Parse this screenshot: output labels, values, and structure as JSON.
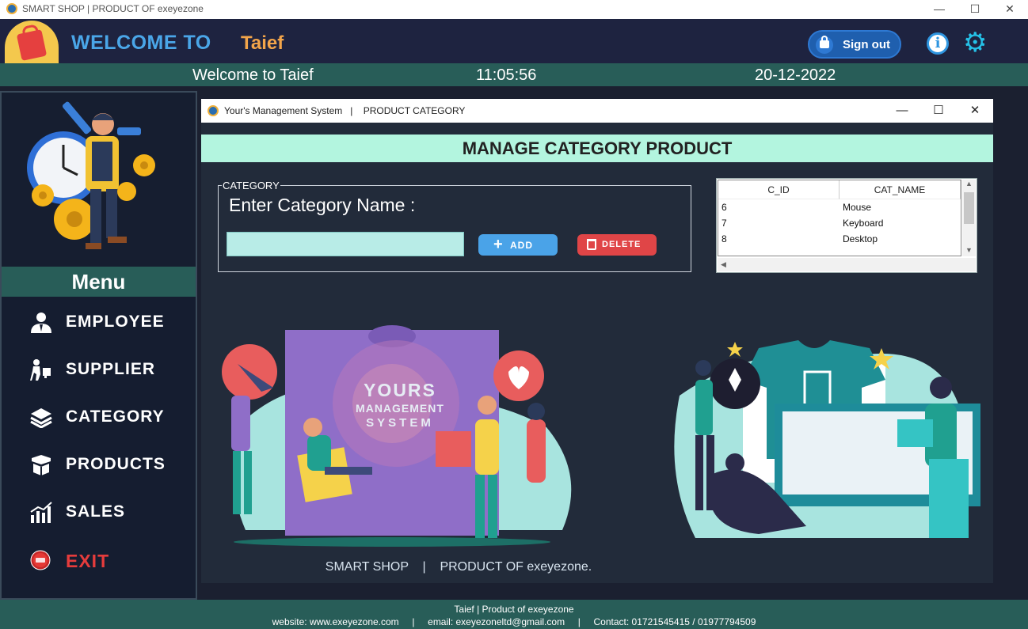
{
  "window": {
    "title": "SMART SHOP | PRODUCT OF exeyezone",
    "minimize": "—",
    "maximize": "☐",
    "close": "✕"
  },
  "header": {
    "welcome_label": "WELCOME TO",
    "user_name": "Taief",
    "signout_label": "Sign out",
    "info_glyph": "i",
    "settings_glyph": "⚙"
  },
  "status": {
    "welcome_text": "Welcome to Taief",
    "time": "11:05:56",
    "date": "20-12-2022"
  },
  "sidebar": {
    "menu_title": "Menu",
    "items": [
      {
        "label": "EMPLOYEE",
        "icon": "employee-icon"
      },
      {
        "label": "SUPPLIER",
        "icon": "supplier-icon"
      },
      {
        "label": "CATEGORY",
        "icon": "category-icon"
      },
      {
        "label": "PRODUCTS",
        "icon": "products-icon"
      },
      {
        "label": "SALES",
        "icon": "sales-icon"
      },
      {
        "label": "EXIT",
        "icon": "exit-icon"
      }
    ]
  },
  "inner_window": {
    "title": "Your's Management System   |    PRODUCT CATEGORY",
    "minimize": "—",
    "maximize": "☐",
    "close": "✕"
  },
  "manage": {
    "heading": "MANAGE CATEGORY PRODUCT",
    "group_label": "CATEGORY",
    "field_label": "Enter Category Name :",
    "field_value": "",
    "add_label": "ADD",
    "delete_label": "DELETE"
  },
  "table": {
    "columns": [
      "C_ID",
      "CAT_NAME"
    ],
    "rows": [
      [
        "6",
        "Mouse"
      ],
      [
        "7",
        "Keyboard"
      ],
      [
        "8",
        "Desktop"
      ]
    ]
  },
  "illustration": {
    "line1": "YOURS",
    "line2": "MANAGEMENT",
    "line3": "SYSTEM"
  },
  "bottom_line": "SMART SHOP    |    PRODUCT OF exeyezone.",
  "footer": {
    "line1": "Taief | Product of exeyezone",
    "line2": "website: www.exeyezone.com     |     email: exeyezoneltd@gmail.com     |     Contact: 01721545415 / 01977794509"
  },
  "colors": {
    "header_bg": "#1e2340",
    "strip_bg": "#285d58",
    "accent_blue": "#4aa6e8",
    "accent_orange": "#f3a54a",
    "heading_band": "#b3f5df",
    "exit_red": "#e63c3c"
  }
}
